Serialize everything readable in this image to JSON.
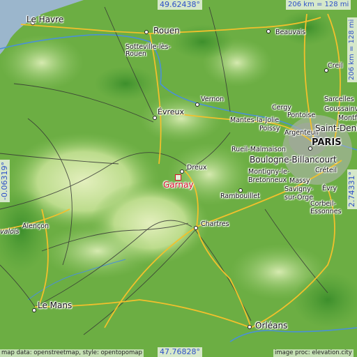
{
  "coords": {
    "top": "49.62438°",
    "bottom": "47.76828°",
    "left": "-0.06319°",
    "right": "2.74331°"
  },
  "scale": {
    "top": "206 km = 128 mi",
    "right": "206 km = 128 mi"
  },
  "attribution": {
    "left": "map data: openstreetmap, style: opentopomap",
    "right": "image proc: elevation.city"
  },
  "target": {
    "name": "Garnay",
    "color": "#d8102a"
  },
  "cities": {
    "le_havre": "Le Havre",
    "rouen": "Rouen",
    "sotteville": "Sotteville-lès-Rouen",
    "evreux": "Évreux",
    "vernon": "Vernon",
    "mantes": "Mantes-la-Jolie",
    "beauvais": "Beauvais",
    "creil": "Creil",
    "paris": "PARIS",
    "cergy": "Cergy",
    "pontoise": "Pontoise",
    "sarcelles": "Sarcelles",
    "goussainville": "Goussainville",
    "montfermeil": "Montfe",
    "saint_denis": "Saint-Denis",
    "poissy": "Poissy",
    "argenteuil": "Argenteuil",
    "rueil": "Rueil-Malmaison",
    "boulogne": "Boulogne-Billancourt",
    "creteil": "Créteil",
    "montigny": "Montigny-le-Bretonneux",
    "massy": "Massy",
    "savigny": "Savigny-sur-Orge",
    "evry": "Évry",
    "corbeil": "Corbeil-Essonnes",
    "dreux": "Dreux",
    "rambouillet": "Rambouillet",
    "chartres": "Chartres",
    "alencon": "Alençon",
    "valois": "valois",
    "le_mans": "Le Mans",
    "orleans": "Orléans"
  },
  "colors": {
    "sea": "#9bb6cc",
    "lowland": "#5fa83c",
    "plateau": "#cfe6a6",
    "road": "#f2c02c",
    "river": "#4a90d9"
  }
}
